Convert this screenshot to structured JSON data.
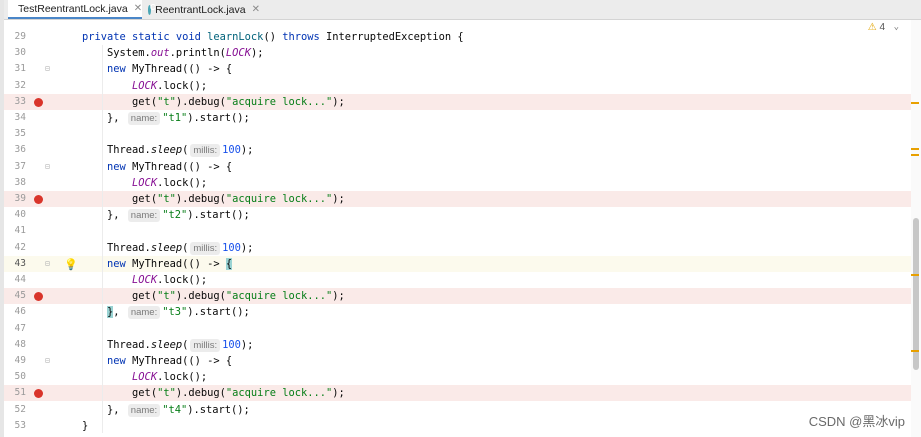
{
  "tabs": [
    {
      "label": "TestReentrantLock.java",
      "icon": "class-icon",
      "active": true
    },
    {
      "label": "ReentrantLock.java",
      "icon": "class-icon",
      "active": false
    }
  ],
  "inspection": {
    "count": "4"
  },
  "watermark": "CSDN @黑冰vip",
  "lines": [
    {
      "n": "29",
      "bp": false,
      "caret": false,
      "html": "<span class=\"kw\">private static void</span> <span class=\"fn\">learnLock</span>() <span class=\"kw\">throws</span> InterruptedException {"
    },
    {
      "n": "30",
      "bp": false,
      "caret": false,
      "html": "    System.<span class=\"it\">out</span>.println(<span class=\"it\">LOCK</span>);"
    },
    {
      "n": "31",
      "bp": false,
      "caret": false,
      "html": "    <span class=\"kw\">new</span> MyThread(() -> {"
    },
    {
      "n": "32",
      "bp": false,
      "caret": false,
      "html": "        <span class=\"it\">LOCK</span>.lock();"
    },
    {
      "n": "33",
      "bp": true,
      "caret": false,
      "html": "        get(<span class=\"st\">\"t\"</span>).debug(<span class=\"st\">\"acquire lock...\"</span>);"
    },
    {
      "n": "34",
      "bp": false,
      "caret": false,
      "html": "    }, <span class=\"hint\">name:</span><span class=\"st\">\"t1\"</span>).start();"
    },
    {
      "n": "35",
      "bp": false,
      "caret": false,
      "html": ""
    },
    {
      "n": "36",
      "bp": false,
      "caret": false,
      "html": "    Thread.<span class=\"itm\">sleep</span>(<span class=\"hint\">millis:</span><span class=\"num\">100</span>);"
    },
    {
      "n": "37",
      "bp": false,
      "caret": false,
      "html": "    <span class=\"kw\">new</span> MyThread(() -> {"
    },
    {
      "n": "38",
      "bp": false,
      "caret": false,
      "html": "        <span class=\"it\">LOCK</span>.lock();"
    },
    {
      "n": "39",
      "bp": true,
      "caret": false,
      "html": "        get(<span class=\"st\">\"t\"</span>).debug(<span class=\"st\">\"acquire lock...\"</span>);"
    },
    {
      "n": "40",
      "bp": false,
      "caret": false,
      "html": "    }, <span class=\"hint\">name:</span><span class=\"st\">\"t2\"</span>).start();"
    },
    {
      "n": "41",
      "bp": false,
      "caret": false,
      "html": ""
    },
    {
      "n": "42",
      "bp": false,
      "caret": false,
      "html": "    Thread.<span class=\"itm\">sleep</span>(<span class=\"hint\">millis:</span><span class=\"num\">100</span>);"
    },
    {
      "n": "43",
      "bp": false,
      "caret": true,
      "html": "    <span class=\"kw\">new</span> MyThread(() -> <span class=\"brhl\">{</span>"
    },
    {
      "n": "44",
      "bp": false,
      "caret": false,
      "html": "        <span class=\"it\">LOCK</span>.lock();"
    },
    {
      "n": "45",
      "bp": true,
      "caret": false,
      "html": "        get(<span class=\"st\">\"t\"</span>).debug(<span class=\"st\">\"acquire lock...\"</span>);"
    },
    {
      "n": "46",
      "bp": false,
      "caret": false,
      "html": "    <span class=\"brhl\">}</span>, <span class=\"hint\">name:</span><span class=\"st\">\"t3\"</span>).start();"
    },
    {
      "n": "47",
      "bp": false,
      "caret": false,
      "html": ""
    },
    {
      "n": "48",
      "bp": false,
      "caret": false,
      "html": "    Thread.<span class=\"itm\">sleep</span>(<span class=\"hint\">millis:</span><span class=\"num\">100</span>);"
    },
    {
      "n": "49",
      "bp": false,
      "caret": false,
      "html": "    <span class=\"kw\">new</span> MyThread(() -> {"
    },
    {
      "n": "50",
      "bp": false,
      "caret": false,
      "html": "        <span class=\"it\">LOCK</span>.lock();"
    },
    {
      "n": "51",
      "bp": true,
      "caret": false,
      "html": "        get(<span class=\"st\">\"t\"</span>).debug(<span class=\"st\">\"acquire lock...\"</span>);"
    },
    {
      "n": "52",
      "bp": false,
      "caret": false,
      "html": "    }, <span class=\"hint\">name:</span><span class=\"st\">\"t4\"</span>).start();"
    },
    {
      "n": "53",
      "bp": false,
      "caret": false,
      "html": "}"
    }
  ],
  "colors": {
    "breakpoint": "#d9352b",
    "keyword": "#0033b3",
    "string": "#067d17",
    "field": "#871094"
  }
}
